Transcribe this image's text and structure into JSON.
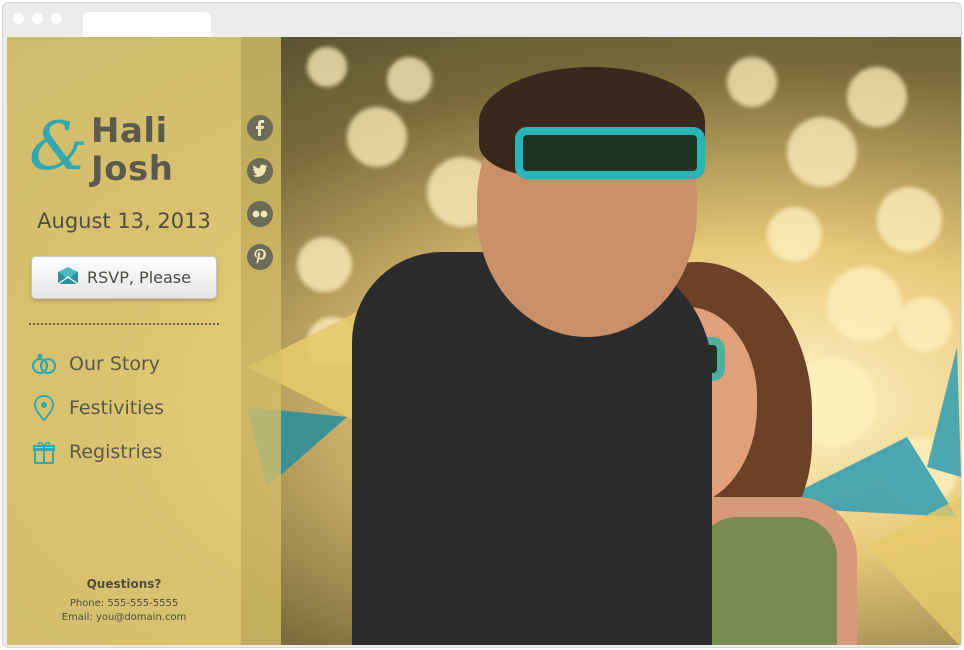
{
  "brand": {
    "first_name": "Hali",
    "second_name": "Josh",
    "ampersand": "&"
  },
  "event": {
    "date": "August 13, 2013"
  },
  "rsvp": {
    "label": "RSVP, Please",
    "icon": "envelope-icon"
  },
  "nav": {
    "items": [
      {
        "label": "Our Story",
        "icon": "rings-icon"
      },
      {
        "label": "Festivities",
        "icon": "map-pin-icon"
      },
      {
        "label": "Registries",
        "icon": "gift-icon"
      }
    ]
  },
  "contact": {
    "title": "Questions?",
    "phone": "Phone: 555-555-5555",
    "email": "Email: you@domain.com"
  },
  "social": [
    {
      "icon": "facebook-icon"
    },
    {
      "icon": "twitter-icon"
    },
    {
      "icon": "flickr-icon"
    },
    {
      "icon": "pinterest-icon"
    }
  ],
  "colors": {
    "accent": "#35a7ad",
    "sidebar": "#eed67b",
    "text": "#5a584a"
  }
}
